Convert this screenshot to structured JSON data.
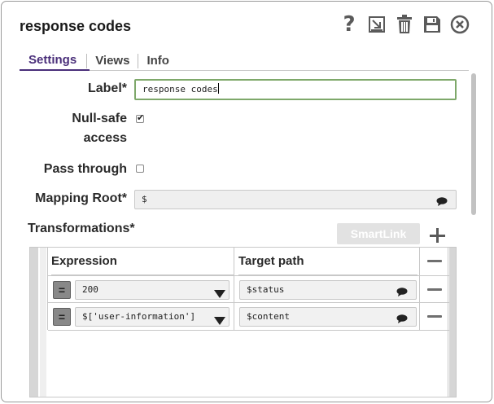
{
  "dialog": {
    "title": "response codes"
  },
  "toolbar": {
    "help": "?",
    "icons": [
      "help-icon",
      "export-icon",
      "trash-icon",
      "save-icon",
      "close-icon"
    ]
  },
  "tabs": [
    {
      "label": "Settings",
      "active": true
    },
    {
      "label": "Views",
      "active": false
    },
    {
      "label": "Info",
      "active": false
    }
  ],
  "form": {
    "label_label": "Label*",
    "label_value": "response codes",
    "nullsafe_label_line1": "Null-safe",
    "nullsafe_label_line2": "access",
    "nullsafe_checked": true,
    "passthrough_label": "Pass through",
    "passthrough_checked": false,
    "mapping_root_label": "Mapping Root*",
    "mapping_root_value": "$",
    "transformations_label": "Transformations*",
    "smartlink_label": "SmartLink"
  },
  "grid": {
    "headers": {
      "expression": "Expression",
      "target": "Target path"
    },
    "rows": [
      {
        "expression": "200",
        "target": "$status"
      },
      {
        "expression": "$['user-information']",
        "target": "$content"
      }
    ],
    "eq_symbol": "="
  },
  "colors": {
    "accent": "#4a2f7a",
    "focus_border": "#7ea86a"
  }
}
